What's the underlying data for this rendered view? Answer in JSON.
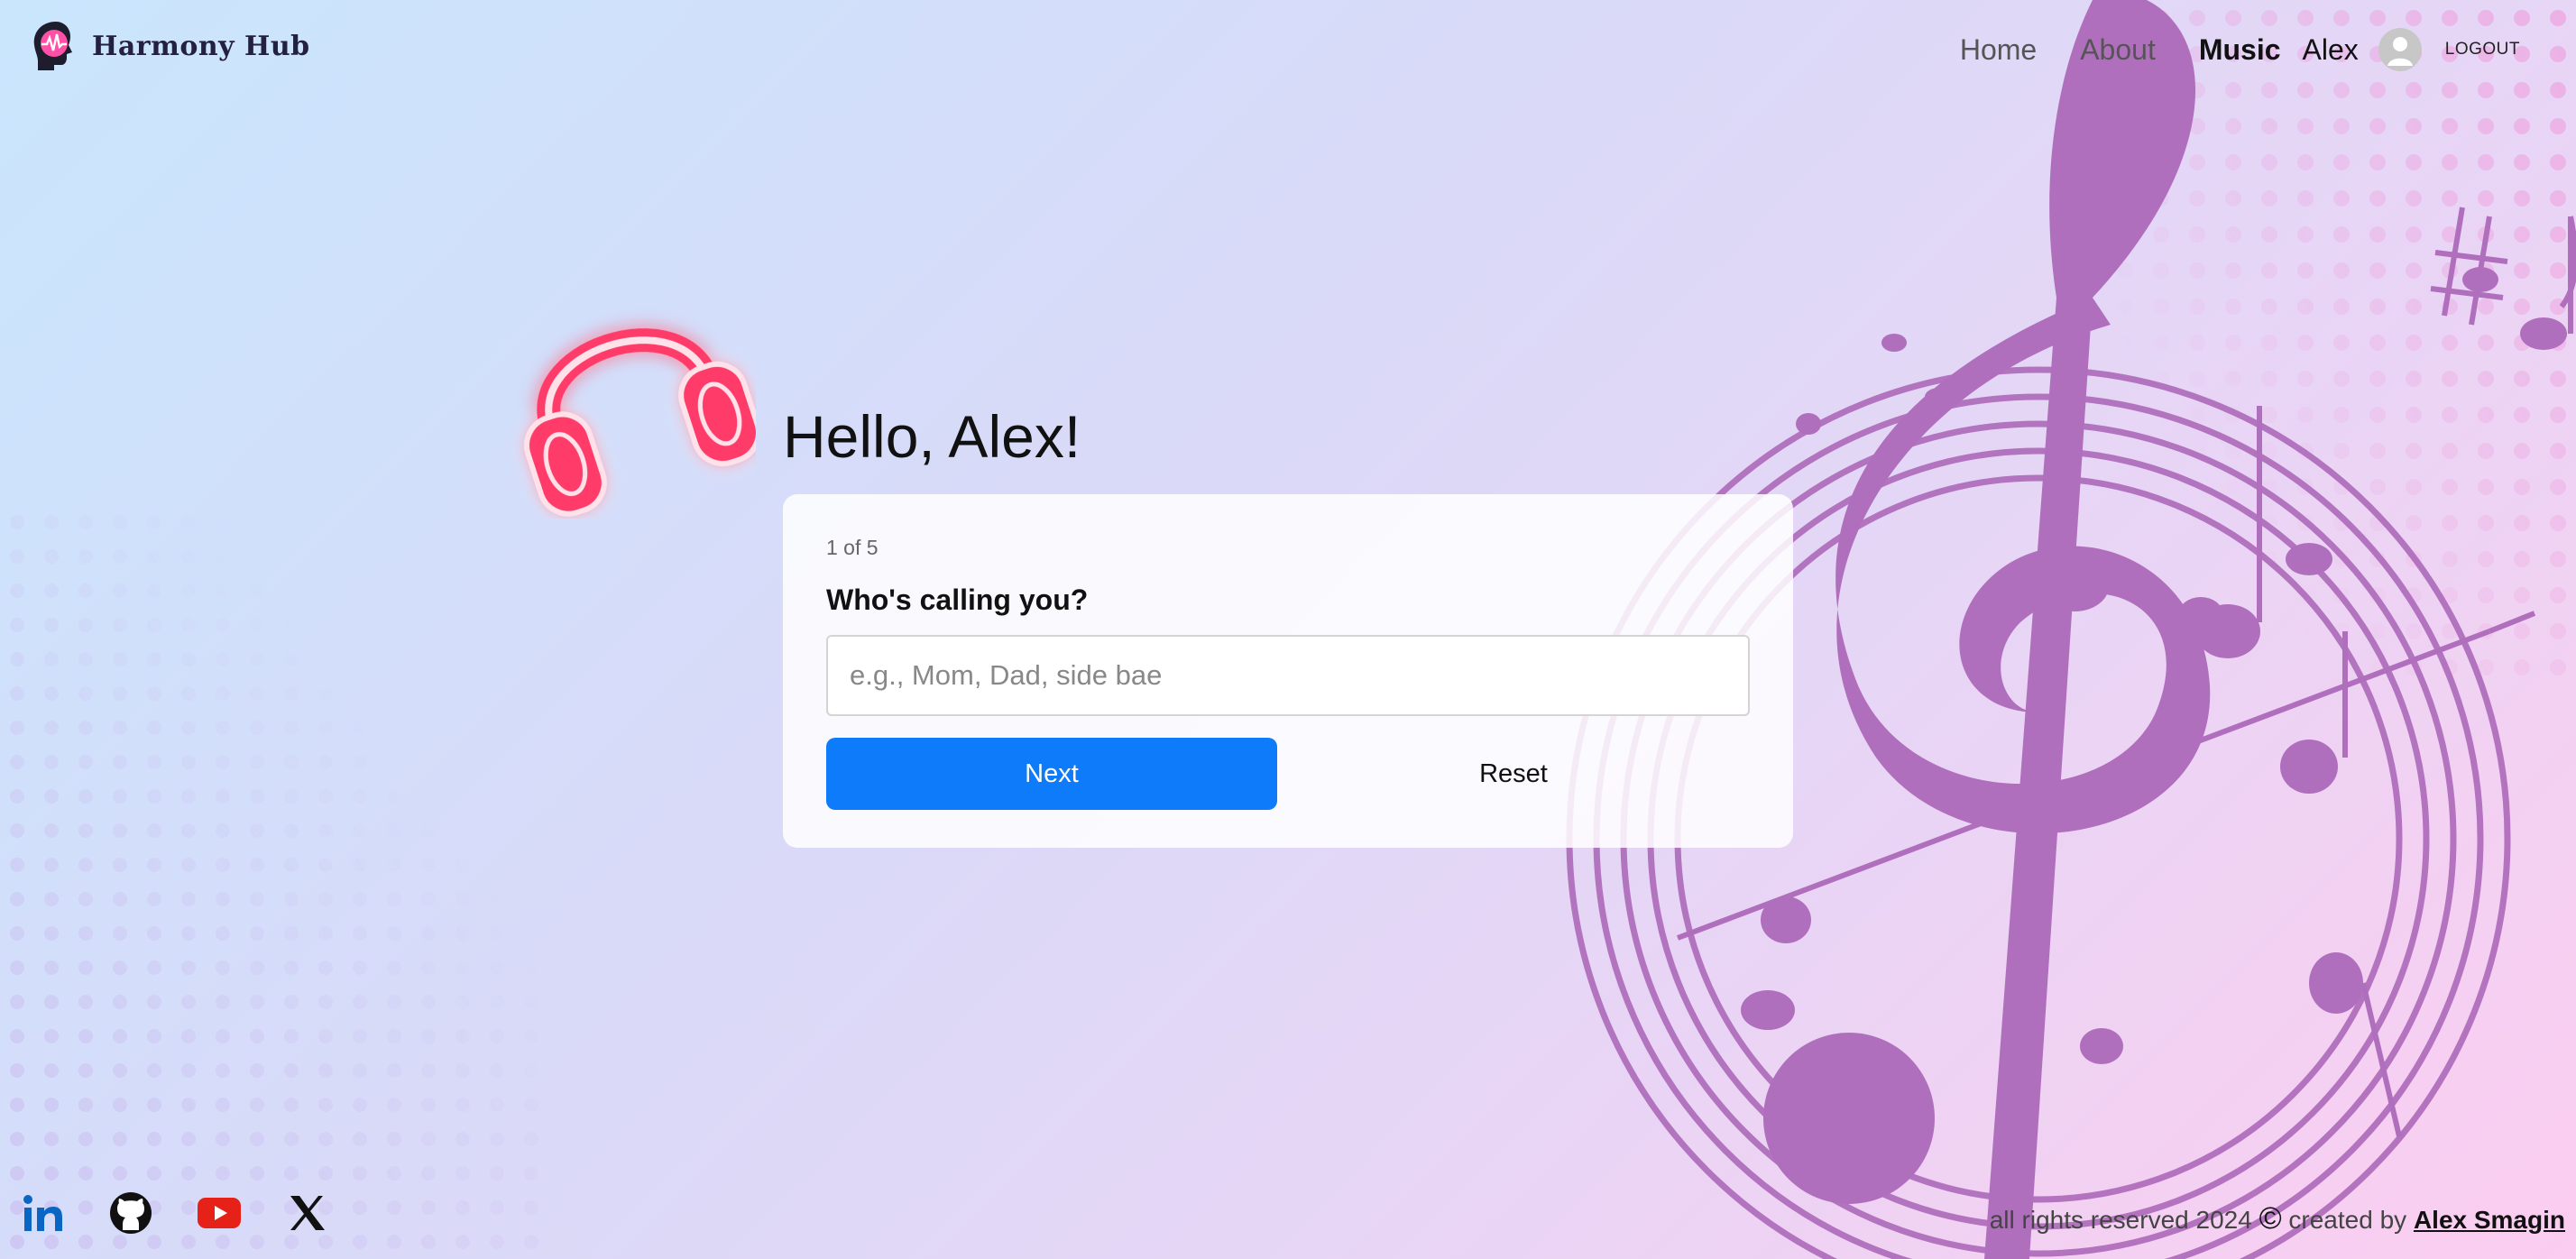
{
  "brand": {
    "name": "Harmony Hub"
  },
  "nav": {
    "links": [
      "Home",
      "About",
      "Music"
    ],
    "active": "Music",
    "user_name": "Alex",
    "logout_label": "LOGOUT"
  },
  "main": {
    "greeting": "Hello, Alex!",
    "form": {
      "step": "1 of 5",
      "question": "Who's calling you?",
      "input_placeholder": "e.g., Mom, Dad, side bae",
      "input_value": "",
      "next_label": "Next",
      "reset_label": "Reset"
    }
  },
  "footer": {
    "socials": [
      "linkedin-icon",
      "github-icon",
      "youtube-icon",
      "x-icon"
    ],
    "copyright": "all rights reserved 2024",
    "copyright_symbol": "©",
    "created_by": "created by",
    "author": "Alex Smagin"
  },
  "colors": {
    "primary_button": "#0d7bfa",
    "decor_purple": "#b06fbd",
    "headphones_pink": "#ff3b6a"
  }
}
